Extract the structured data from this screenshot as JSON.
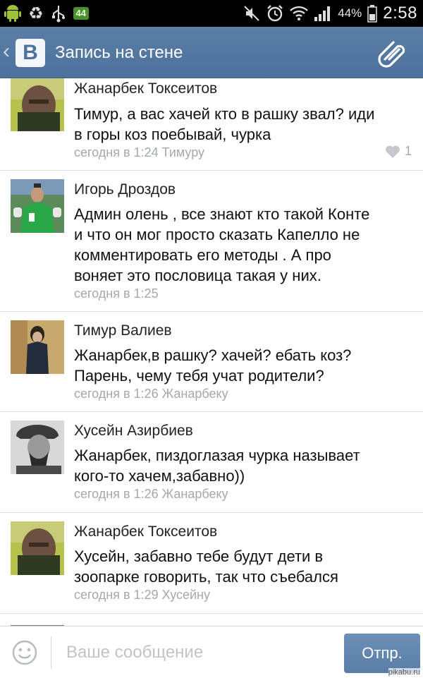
{
  "status_bar": {
    "badge": "44",
    "battery": "44%",
    "time": "2:58"
  },
  "header": {
    "logo": "В",
    "title": "Запись на стене",
    "back_icon": "chevron-left-icon",
    "attach_icon": "paperclip-icon"
  },
  "comments": [
    {
      "name": "Жанарбек Токсеитов",
      "lines": [
        "Тимур, а вас хачей кто в рашку звал? иди",
        "в горы коз поебывай, чурка"
      ],
      "meta": "сегодня в 1:24 Тимуру",
      "likes": "1"
    },
    {
      "name": "Игорь Дроздов",
      "lines": [
        "Админ олень , все знают кто такой Конте",
        "и что он мог просто сказать Капелло не",
        "комментировать его методы . А про",
        "воняет это пословица такая у них."
      ],
      "meta": "сегодня в 1:25"
    },
    {
      "name": "Тимур Валиев",
      "lines": [
        "Жанарбек,в рашку? хачей? ебать коз?",
        "Парень, чему тебя учат родители?"
      ],
      "meta": "сегодня в 1:26 Жанарбеку"
    },
    {
      "name": "Хусейн Азирбиев",
      "lines": [
        "Жанарбек, пиздоглазая чурка называет",
        "кого-то хачем,забавно))"
      ],
      "meta": "сегодня в 1:26 Жанарбеку"
    },
    {
      "name": "Жанарбек Токсеитов",
      "lines": [
        "Хусейн, забавно тебе будут дети в",
        "зоопарке говорить, так что съебался"
      ],
      "meta": "сегодня в 1:29 Хусейну"
    }
  ],
  "compose": {
    "placeholder": "Ваше сообщение",
    "value": "",
    "send_label": "Отпр."
  },
  "watermark": "pikabu.ru",
  "colors": {
    "header": "#5a7ea6",
    "meta_text": "#a3a8ae",
    "send_button": "#5a7ea6"
  }
}
